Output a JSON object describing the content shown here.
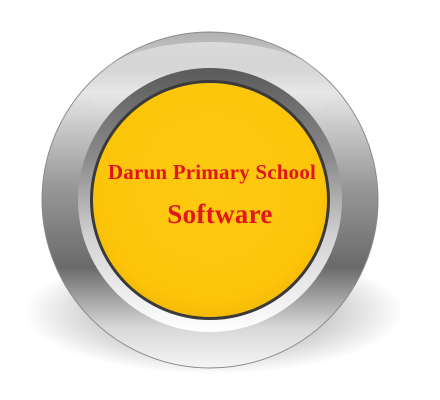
{
  "button": {
    "line1": "Darun Primary School",
    "line2": "Software",
    "text_color": "#e3141b",
    "face_color": "#fdc60c",
    "ring_colors": {
      "light": "#f4f4f4",
      "mid": "#b9b9b9",
      "dark": "#5f5f5f",
      "inner_edge": "#3a3a3a"
    }
  }
}
